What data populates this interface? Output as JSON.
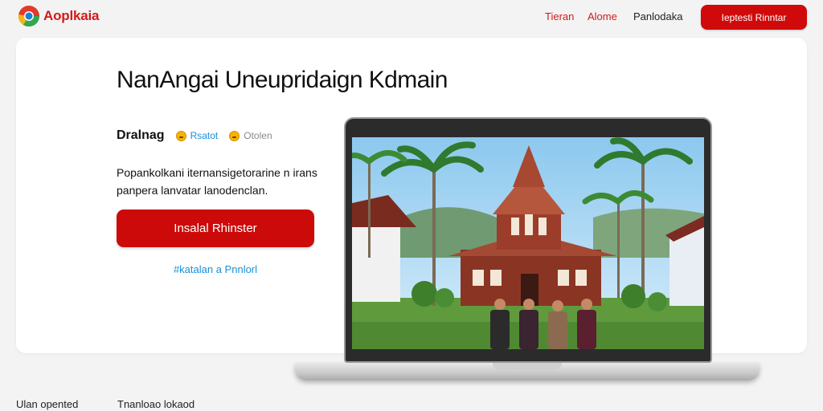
{
  "brand": {
    "name": "Aoplkaia",
    "accent_color": "#d21a1a",
    "logo_icon": "circular-logo-icon"
  },
  "nav": {
    "links": [
      "Tieran",
      "Alome",
      "Panlodaka"
    ],
    "button_label": "Ieptesti Rinntar"
  },
  "hero": {
    "title": "NanAngai Uneupridaign Kdmain",
    "subtitle_label": "Dralnag",
    "badges": [
      {
        "icon": "emoji-face-icon",
        "text": "Rsatot"
      },
      {
        "icon": "emoji-face-icon",
        "text": "Otolen"
      }
    ],
    "description": "Popankolkani iternansigetorarine n irans panpera lanvatar lanodenclan.",
    "cta_label": "Insalal Rhinster",
    "secondary_link": "#katalan a Pnnlorl"
  },
  "preview": {
    "image_subject": "traditional-wooden-house-photo"
  },
  "footer": {
    "items": [
      "Ulan opented",
      "Tnanloao lokaod"
    ]
  }
}
